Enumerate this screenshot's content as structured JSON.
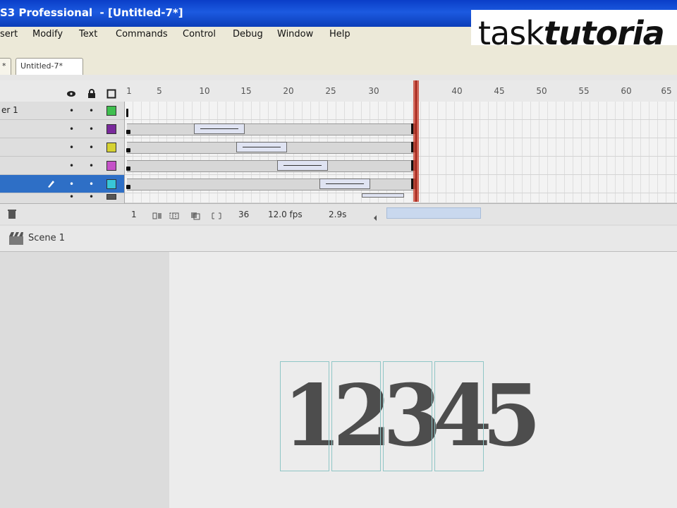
{
  "window": {
    "title": "S3 Professional  - [Untitled-7*]"
  },
  "menu": [
    "sert",
    "Modify",
    "Text",
    "Commands",
    "Control",
    "Debug",
    "Window",
    "Help"
  ],
  "logo": {
    "regular": "task",
    "bold": "tutoria"
  },
  "tabs": [
    "*",
    "Untitled-7*"
  ],
  "timeline": {
    "ruler_labels": [
      "1",
      "5",
      "10",
      "15",
      "20",
      "25",
      "30",
      "40",
      "45",
      "50",
      "55",
      "60",
      "65"
    ],
    "layers": [
      {
        "name": "er 1",
        "color": "#3fbf4f"
      },
      {
        "name": "",
        "color": "#7a2a9c"
      },
      {
        "name": "",
        "color": "#d6d232"
      },
      {
        "name": "",
        "color": "#c552c8"
      },
      {
        "name": "",
        "color": "#38c6d8",
        "selected": true
      },
      {
        "name": "",
        "color": "#555555"
      }
    ],
    "status": {
      "frame": "1",
      "current_frame": "36",
      "fps": "12.0 fps",
      "time": "2.9s"
    }
  },
  "scene": {
    "label": "Scene 1"
  },
  "stage": {
    "digits": [
      "1",
      "2",
      "3",
      "4",
      "5"
    ]
  }
}
